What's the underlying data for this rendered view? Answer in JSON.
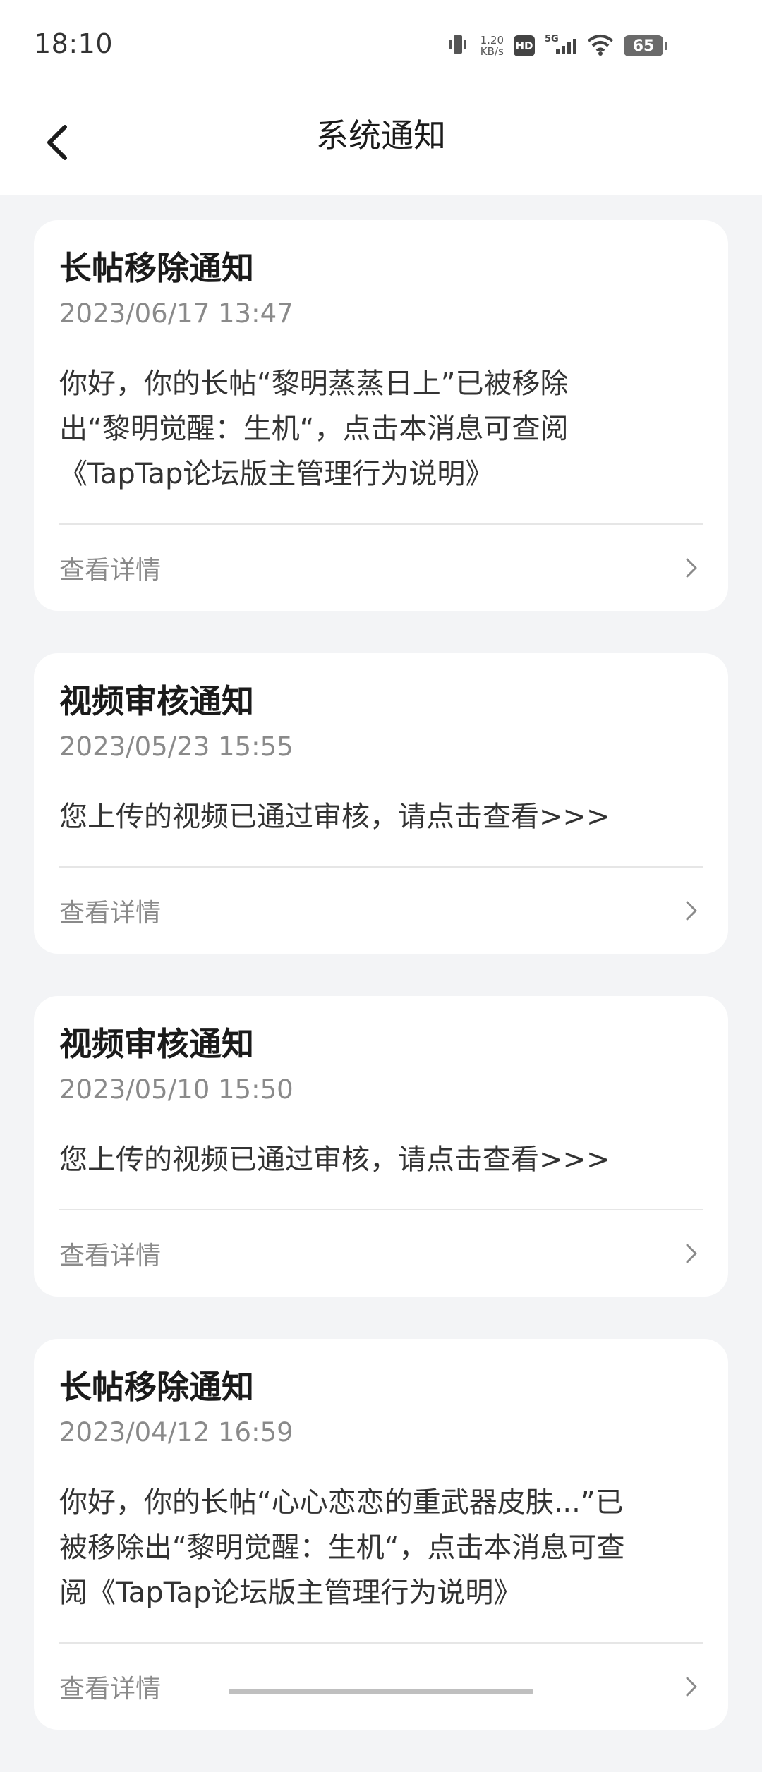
{
  "status_bar": {
    "time": "18:10",
    "net_speed_value": "1.20",
    "net_speed_unit": "KB/s",
    "hd": "HD",
    "network": "5G",
    "battery": "65"
  },
  "header": {
    "title": "系统通知",
    "back_icon": "chevron-left-icon"
  },
  "notifications": [
    {
      "title": "长帖移除通知",
      "date": "2023/06/17 13:47",
      "body": "你好，你的长帖“黎明蒸蒸日上”已被移除出“黎明觉醒：生机“，点击本消息可查阅《TapTap论坛版主管理行为说明》",
      "detail_label": "查看详情"
    },
    {
      "title": "视频审核通知",
      "date": "2023/05/23 15:55",
      "body": "您上传的视频已通过审核，请点击查看>>>",
      "detail_label": "查看详情"
    },
    {
      "title": "视频审核通知",
      "date": "2023/05/10 15:50",
      "body": "您上传的视频已通过审核，请点击查看>>>",
      "detail_label": "查看详情"
    },
    {
      "title": "长帖移除通知",
      "date": "2023/04/12 16:59",
      "body": "你好，你的长帖“心心恋恋的重武器皮肤...”已被移除出“黎明觉醒：生机“，点击本消息可查阅《TapTap论坛版主管理行为说明》",
      "detail_label": "查看详情"
    }
  ]
}
